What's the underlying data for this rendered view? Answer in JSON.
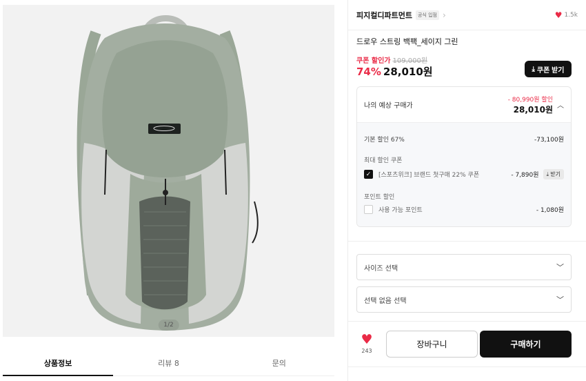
{
  "gallery": {
    "counter": "1/2"
  },
  "tabs": [
    {
      "label": "상품정보"
    },
    {
      "label": "리뷰 8"
    },
    {
      "label": "문의"
    }
  ],
  "brand": {
    "name": "피지컬디파트먼트",
    "badge": "공식 입점",
    "likes": "1.5k"
  },
  "product": {
    "title": "드로우 스트링 백팩_세이지 그린",
    "coupon_label": "쿠폰 할인가",
    "original_price": "109,000원",
    "discount_pct": "74%",
    "price": "28,010원",
    "coupon_button": "쿠폰 받기"
  },
  "estimate": {
    "label": "나의 예상 구매가",
    "discount_total": "- 80,990원 할인",
    "price": "28,010원",
    "base_label": "기본 할인 67%",
    "base_value": "-73,100원",
    "max_coupon_label": "최대 할인 쿠폰",
    "coupon_name": "[스포츠위크] 브랜드 첫구매 22% 쿠폰",
    "coupon_value": "- 7,890원",
    "coupon_get": "받기",
    "point_label": "포인트 할인",
    "point_name": "사용 가능 포인트",
    "point_value": "- 1,080원"
  },
  "options": {
    "size": "사이즈 선택",
    "none": "선택 없음 선택"
  },
  "actions": {
    "wish_count": "243",
    "cart": "장바구니",
    "buy": "구매하기"
  },
  "colors": {
    "accent_red": "#ea2b47",
    "dark": "#111111"
  }
}
